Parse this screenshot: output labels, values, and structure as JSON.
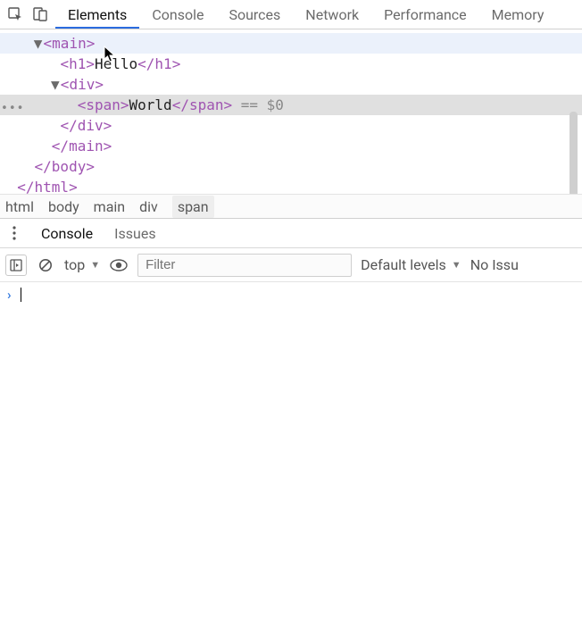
{
  "top_tabs": {
    "items": [
      "Elements",
      "Console",
      "Sources",
      "Network",
      "Performance",
      "Memory"
    ],
    "active_index": 0
  },
  "dom": {
    "rows": [
      {
        "indent": 34,
        "twisty": "▼",
        "pre": "<",
        "tag": "main",
        "post": ">",
        "hover": true
      },
      {
        "indent": 66,
        "pre": "<",
        "tag": "h1",
        "mid": ">",
        "text": "Hello",
        "close_pre": "</",
        "close_tag": "h1",
        "close_post": ">"
      },
      {
        "indent": 50,
        "twisty": "▼",
        "pre": "<",
        "tag": "div",
        "post": ">"
      },
      {
        "indent": 82,
        "pre": "<",
        "tag": "span",
        "mid": ">",
        "text": "World",
        "close_pre": "</",
        "close_tag": "span",
        "close_post": ">",
        "suffix": " == $0",
        "selected": true,
        "dots": true
      },
      {
        "indent": 66,
        "pre": "</",
        "tag": "div",
        "post": ">"
      },
      {
        "indent": 50,
        "pre": "</",
        "tag": "main",
        "post": ">"
      },
      {
        "indent": 34,
        "pre": "</",
        "tag": "body",
        "post": ">"
      },
      {
        "indent": 18,
        "pre": "</",
        "tag": "html",
        "post": ">"
      }
    ]
  },
  "breadcrumb": {
    "items": [
      "html",
      "body",
      "main",
      "div",
      "span"
    ],
    "current_index": 4
  },
  "drawer": {
    "tabs": [
      "Console",
      "Issues"
    ],
    "active_index": 0
  },
  "console": {
    "context": "top",
    "filter_placeholder": "Filter",
    "levels_label": "Default levels",
    "noissues_label": "No Issu"
  }
}
